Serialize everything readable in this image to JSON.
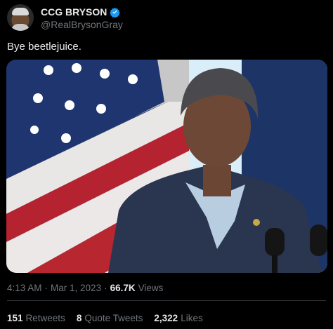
{
  "tweet": {
    "author": {
      "display_name": "CCG BRYSON",
      "handle": "@RealBrysonGray",
      "verified": true
    },
    "text": "Bye beetlejuice.",
    "time": "4:13 AM",
    "sep1": "·",
    "date": "Mar 1, 2023",
    "sep2": "·",
    "views_count": "66.7K",
    "views_label": "Views"
  },
  "stats": {
    "retweets_count": "151",
    "retweets_label": "Retweets",
    "quotes_count": "8",
    "quotes_label": "Quote Tweets",
    "likes_count": "2,322",
    "likes_label": "Likes"
  },
  "colors": {
    "background": "#000000",
    "text_primary": "#e7e9ea",
    "text_secondary": "#71767b",
    "verified_blue": "#1d9bf0",
    "divider": "#2f3336"
  }
}
